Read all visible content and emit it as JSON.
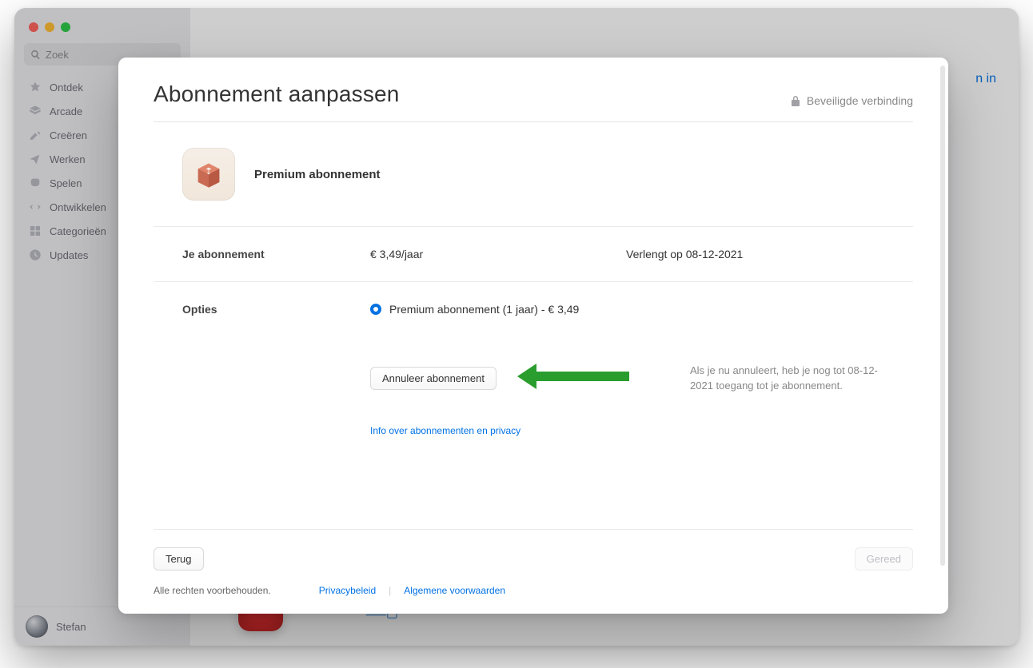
{
  "bg": {
    "search_placeholder": "Zoek",
    "nav": [
      "Ontdek",
      "Arcade",
      "Creëren",
      "Werken",
      "Spelen",
      "Ontwikkelen",
      "Categorieën",
      "Updates"
    ],
    "user": "Stefan",
    "signin_fragment": "n in"
  },
  "modal": {
    "title": "Abonnement aanpassen",
    "secure": "Beveiligde verbinding",
    "product_name": "Premium abonnement",
    "sub_label": "Je abonnement",
    "price": "€ 3,49/jaar",
    "renews": "Verlengt op 08-12-2021",
    "options_label": "Opties",
    "option_text": "Premium abonnement (1 jaar) - € 3,49",
    "cancel_btn": "Annuleer abonnement",
    "cancel_note": "Als je nu annuleert, heb je nog tot 08-12-2021 toegang tot je abonnement.",
    "privacy_info_link": "Info over abonnementen en privacy",
    "back_btn": "Terug",
    "done_btn": "Gereed",
    "rights": "Alle rechten voorbehouden.",
    "footer_privacy": "Privacybeleid",
    "footer_terms": "Algemene voorwaarden"
  }
}
